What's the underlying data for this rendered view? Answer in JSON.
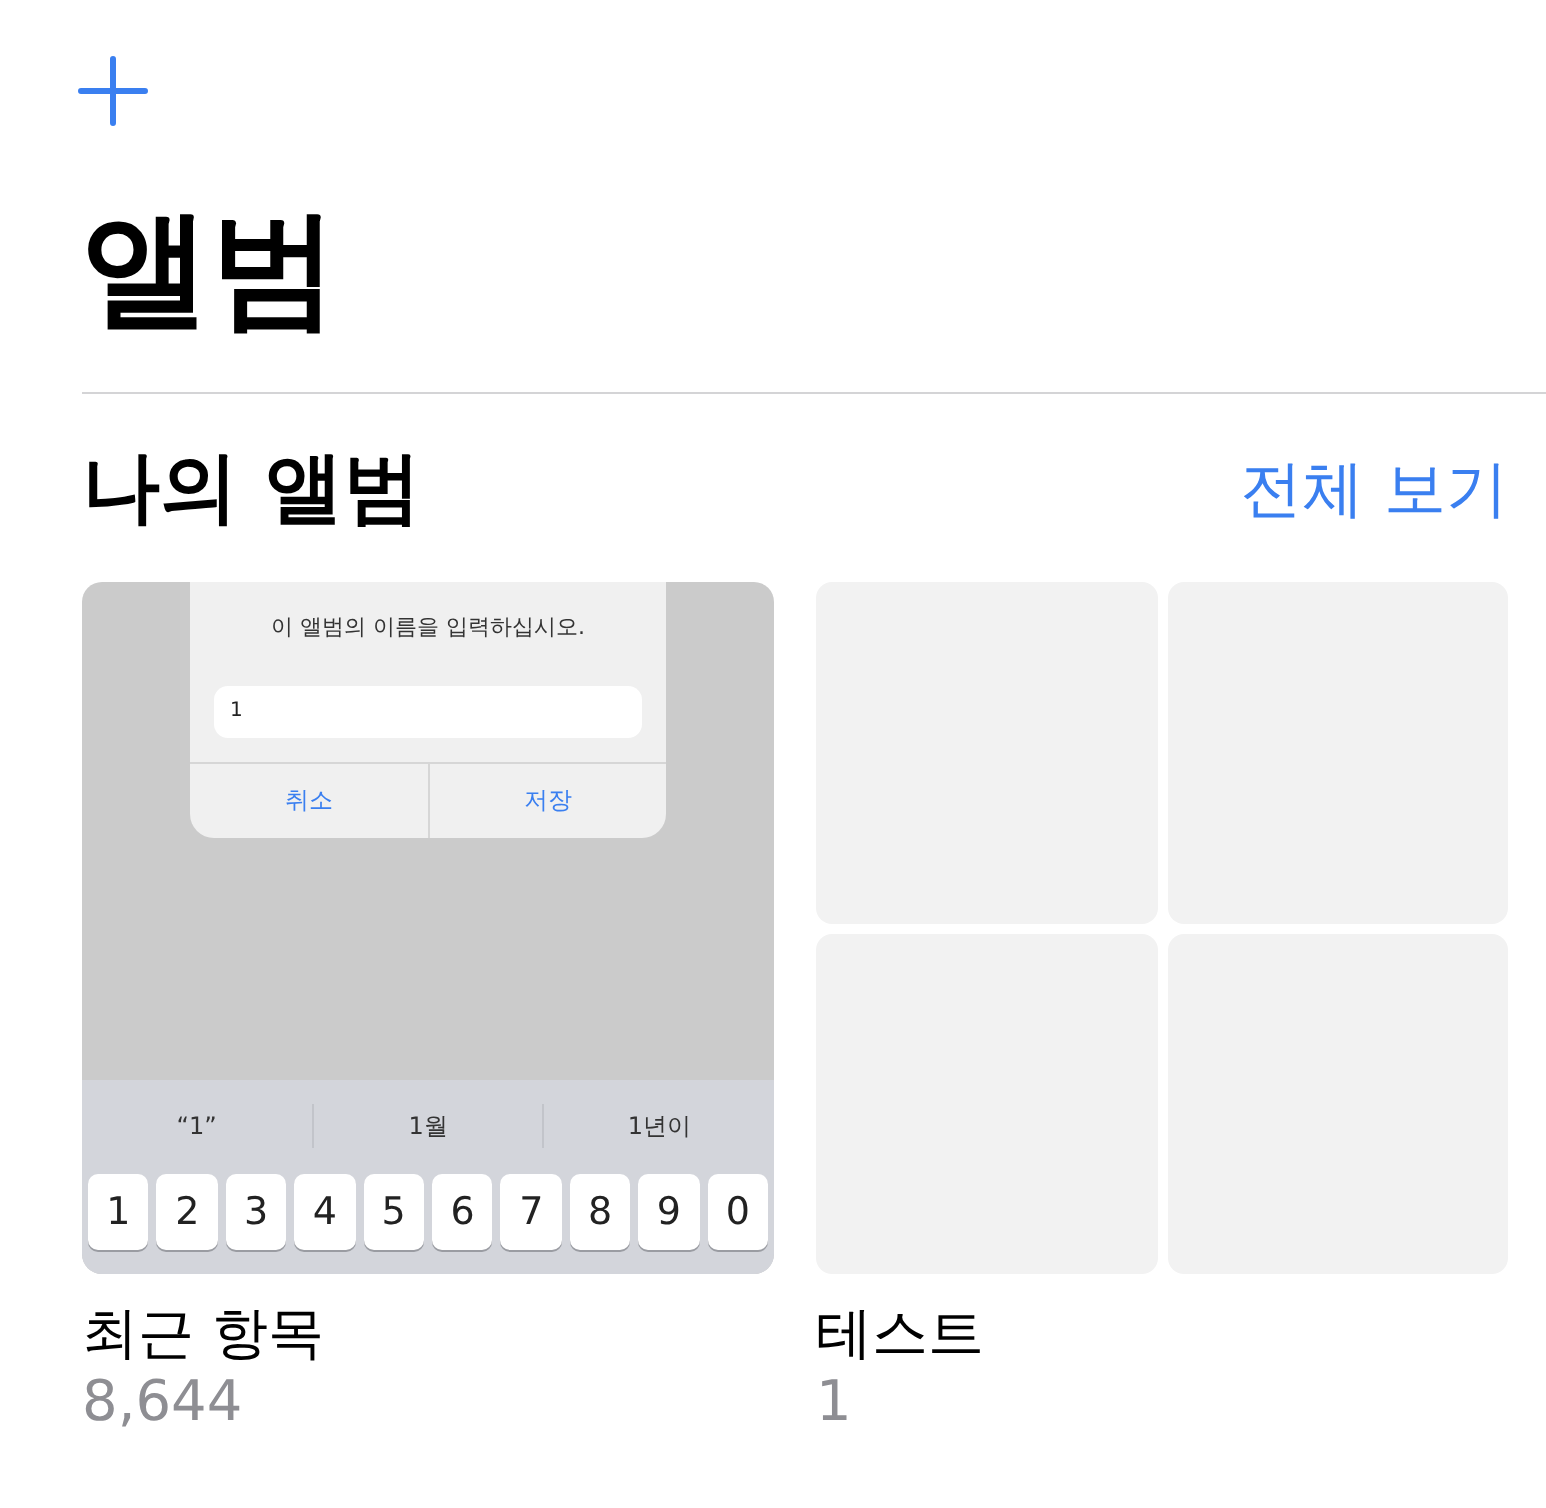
{
  "title": "앨범",
  "section": {
    "title": "나의 앨범",
    "see_all": "전체 보기"
  },
  "albums": [
    {
      "kind": "screenshot",
      "name": "최근 항목",
      "count": "8,644",
      "thumbnail": {
        "message": "이 앨범의 이름을 입력하십시오.",
        "input_value": "1",
        "buttons": [
          "취소",
          "저장"
        ],
        "suggestions": [
          "“1”",
          "1월",
          "1년이"
        ],
        "keys": [
          "1",
          "2",
          "3",
          "4",
          "5",
          "6",
          "7",
          "8",
          "9",
          "0"
        ]
      }
    },
    {
      "kind": "empty_grid",
      "name": "테스트",
      "count": "1"
    }
  ]
}
